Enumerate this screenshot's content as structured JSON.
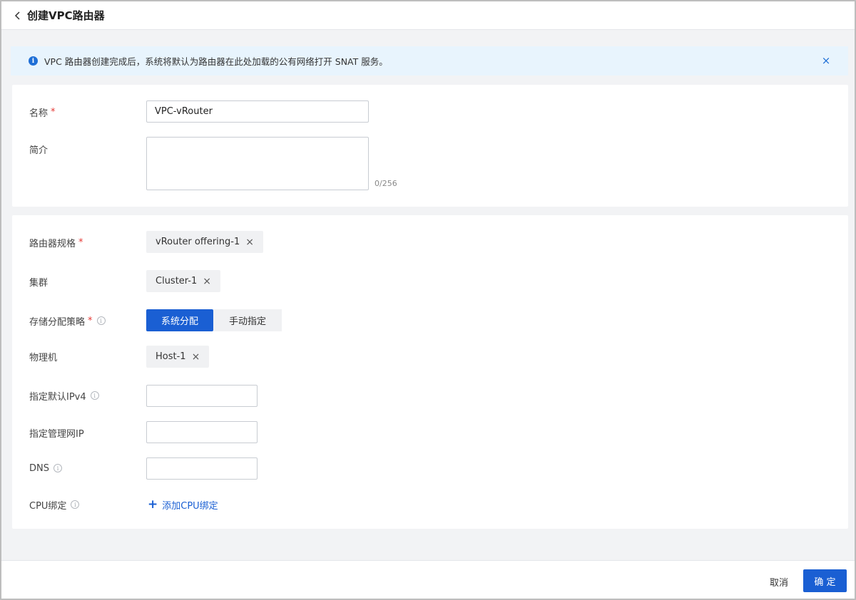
{
  "header": {
    "title": "创建VPC路由器",
    "back_icon": "chevron-left-icon"
  },
  "notice": {
    "text": "VPC 路由器创建完成后，系统将默认为路由器在此处加载的公有网络打开 SNAT 服务。",
    "close": "×",
    "info_glyph": "i",
    "accent_color": "#1f6fd6"
  },
  "basic": {
    "name_label": "名称",
    "name_value": "VPC-vRouter",
    "desc_label": "简介",
    "desc_value": "",
    "desc_counter": "0/256"
  },
  "config": {
    "offering_label": "路由器规格",
    "offering_value": "vRouter offering-1",
    "cluster_label": "集群",
    "cluster_value": "Cluster-1",
    "storage_label": "存储分配策略",
    "storage_options": [
      "系统分配",
      "手动指定"
    ],
    "storage_selected": "系统分配",
    "host_label": "物理机",
    "host_value": "Host-1",
    "ipv4_label": "指定默认IPv4",
    "ipv4_value": "",
    "mgmt_ip_label": "指定管理网IP",
    "mgmt_ip_value": "",
    "dns_label": "DNS",
    "dns_value": "",
    "cpu_label": "CPU绑定",
    "add_cpu_label": "添加CPU绑定"
  },
  "common": {
    "required_mark": "*",
    "tag_remove": "×",
    "tip_glyph": "i",
    "plus_glyph": "+"
  },
  "footer": {
    "cancel_label": "取消",
    "confirm_label": "确 定",
    "primary_color": "#1a5fd3"
  }
}
